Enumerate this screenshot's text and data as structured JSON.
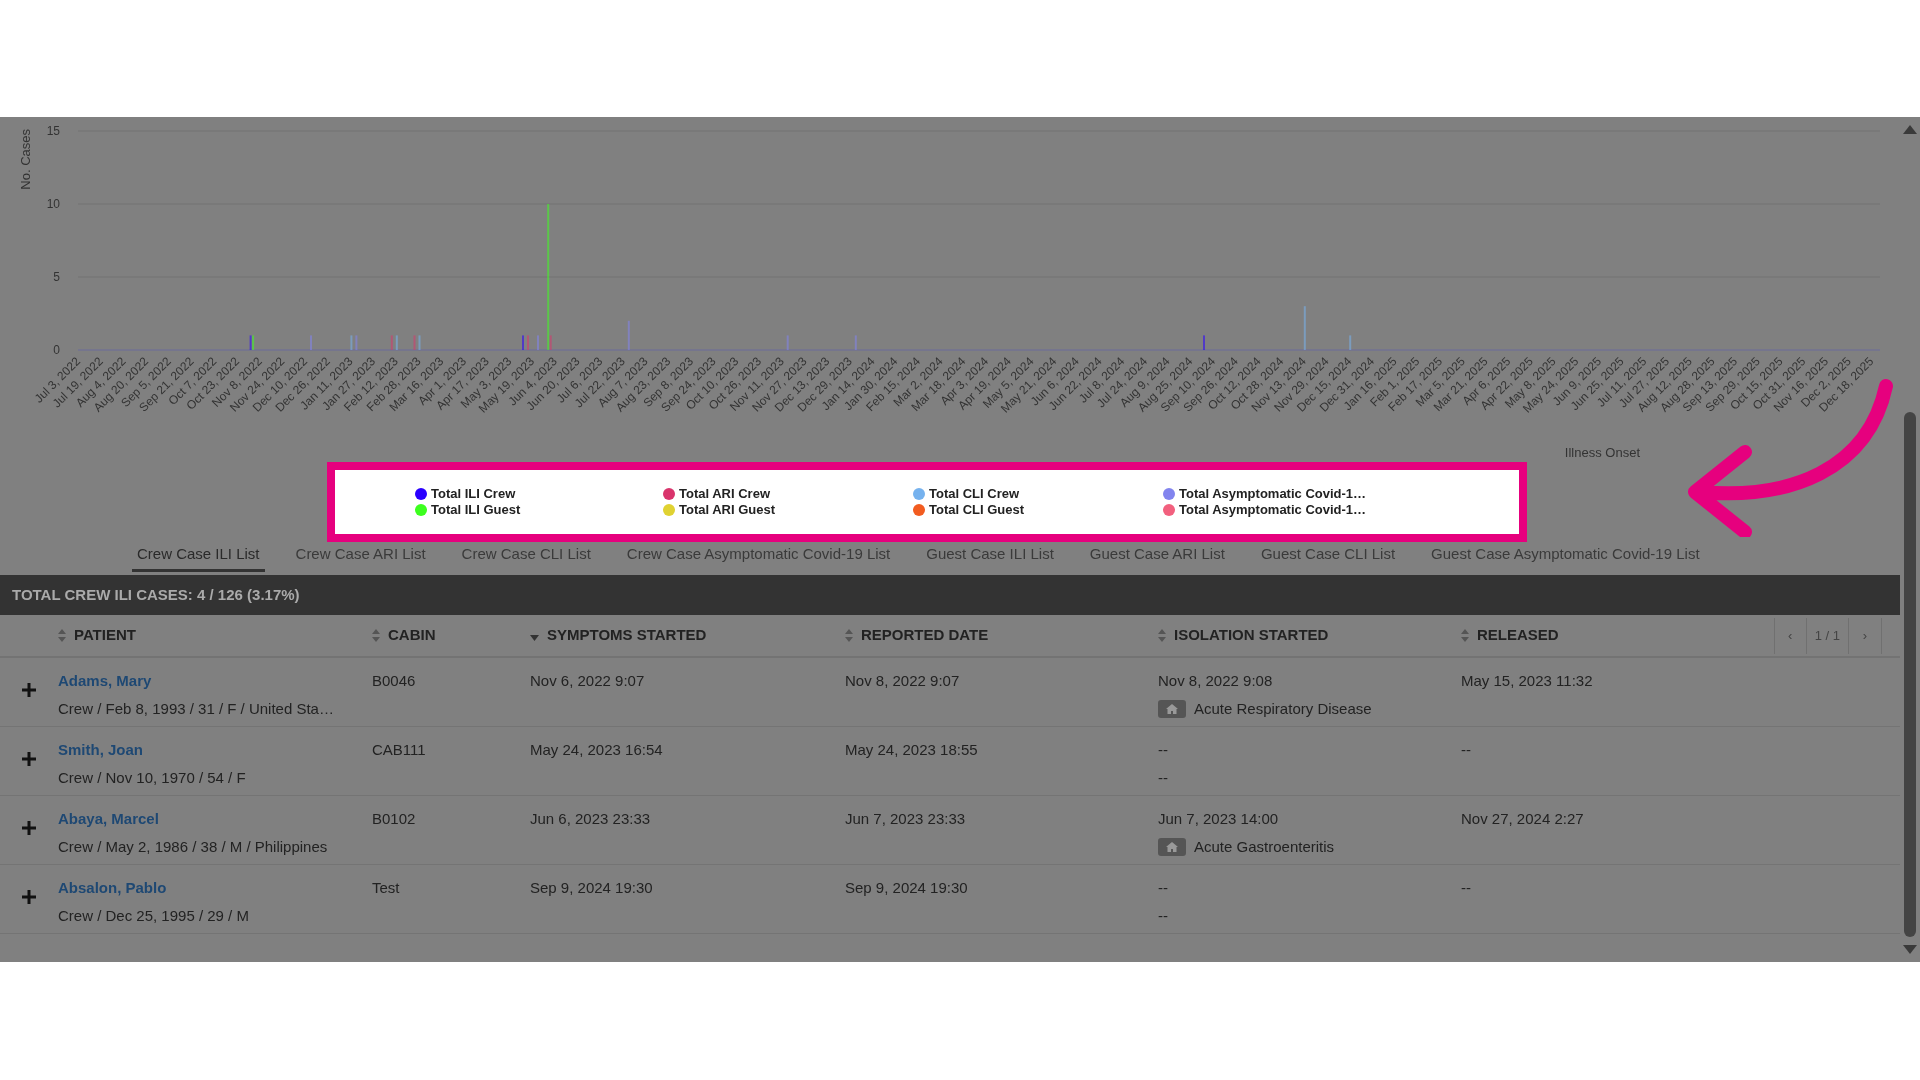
{
  "chart": {
    "chart_data": {
      "type": "bar",
      "ylabel": "No. Cases",
      "xlabel": "Illness Onset",
      "ylim": [
        0,
        15
      ],
      "yticks": [
        0,
        5,
        10,
        15
      ],
      "categories": [
        "Jul 3, 2022",
        "Jul 19, 2022",
        "Aug 4, 2022",
        "Aug 20, 2022",
        "Sep 5, 2022",
        "Sep 21, 2022",
        "Oct 7, 2022",
        "Oct 23, 2022",
        "Nov 8, 2022",
        "Nov 24, 2022",
        "Dec 10, 2022",
        "Dec 26, 2022",
        "Jan 11, 2023",
        "Jan 27, 2023",
        "Feb 12, 2023",
        "Feb 28, 2023",
        "Mar 16, 2023",
        "Apr 1, 2023",
        "Apr 17, 2023",
        "May 3, 2023",
        "May 19, 2023",
        "Jun 4, 2023",
        "Jun 20, 2023",
        "Jul 6, 2023",
        "Jul 22, 2023",
        "Aug 7, 2023",
        "Aug 23, 2023",
        "Sep 8, 2023",
        "Sep 24, 2023",
        "Oct 10, 2023",
        "Oct 26, 2023",
        "Nov 11, 2023",
        "Nov 27, 2023",
        "Dec 13, 2023",
        "Dec 29, 2023",
        "Jan 14, 2024",
        "Jan 30, 2024",
        "Feb 15, 2024",
        "Mar 2, 2024",
        "Mar 18, 2024",
        "Apr 3, 2024",
        "Apr 19, 2024",
        "May 5, 2024",
        "May 21, 2024",
        "Jun 6, 2024",
        "Jun 22, 2024",
        "Jul 8, 2024",
        "Jul 24, 2024",
        "Aug 9, 2024",
        "Aug 25, 2024",
        "Sep 10, 2024",
        "Sep 26, 2024",
        "Oct 12, 2024",
        "Oct 28, 2024",
        "Nov 13, 2024",
        "Nov 29, 2024",
        "Dec 15, 2024",
        "Dec 31, 2024",
        "Jan 16, 2025",
        "Feb 1, 2025",
        "Feb 17, 2025",
        "Mar 5, 2025",
        "Mar 21, 2025",
        "Apr 6, 2025",
        "Apr 22, 2025",
        "May 8, 2025",
        "May 24, 2025",
        "Jun 9, 2025",
        "Jun 25, 2025",
        "Jul 11, 2025",
        "Jul 27, 2025",
        "Aug 12, 2025",
        "Aug 28, 2025",
        "Sep 13, 2025",
        "Sep 29, 2025",
        "Oct 15, 2025",
        "Oct 31, 2025",
        "Nov 16, 2025",
        "Dec 2, 2025",
        "Dec 18, 2025"
      ],
      "series": [
        {
          "name": "Total ILI Crew",
          "color": "#2a00ff",
          "values": [
            0,
            0,
            0,
            0,
            0,
            0,
            0,
            0,
            1,
            0,
            0,
            0,
            0,
            0,
            0,
            0,
            0,
            0,
            0,
            0,
            1,
            0,
            0,
            0,
            0,
            0,
            0,
            0,
            0,
            0,
            0,
            0,
            0,
            0,
            0,
            0,
            0,
            0,
            0,
            0,
            0,
            0,
            0,
            0,
            0,
            0,
            0,
            0,
            0,
            0,
            1,
            0,
            0,
            0,
            0,
            0,
            0,
            0,
            0,
            0,
            0,
            0,
            0,
            0,
            0,
            0,
            0,
            0,
            0,
            0,
            0,
            0,
            0,
            0,
            0,
            0,
            0,
            0,
            0,
            0
          ]
        },
        {
          "name": "Total ILI Guest",
          "color": "#3cff1e",
          "values": [
            0,
            0,
            0,
            0,
            0,
            0,
            0,
            0,
            1,
            0,
            0,
            0,
            0,
            0,
            0,
            0,
            0,
            0,
            0,
            0,
            0,
            10,
            0,
            0,
            0,
            0,
            0,
            0,
            0,
            0,
            0,
            0,
            0,
            0,
            0,
            0,
            0,
            0,
            0,
            0,
            0,
            0,
            0,
            0,
            0,
            0,
            0,
            0,
            0,
            0,
            0,
            0,
            0,
            0,
            0,
            0,
            0,
            0,
            0,
            0,
            0,
            0,
            0,
            0,
            0,
            0,
            0,
            0,
            0,
            0,
            0,
            0,
            0,
            0,
            0,
            0,
            0,
            0,
            0,
            0
          ]
        },
        {
          "name": "Total ARI Crew",
          "color": "#d9346c",
          "values": [
            0,
            0,
            0,
            0,
            0,
            0,
            0,
            0,
            0,
            0,
            0,
            0,
            0,
            0,
            1,
            1,
            0,
            0,
            0,
            0,
            1,
            1,
            0,
            0,
            0,
            0,
            0,
            0,
            0,
            0,
            0,
            0,
            0,
            0,
            0,
            0,
            0,
            0,
            0,
            0,
            0,
            0,
            0,
            0,
            0,
            0,
            0,
            0,
            0,
            0,
            0,
            0,
            0,
            0,
            0,
            0,
            0,
            0,
            0,
            0,
            0,
            0,
            0,
            0,
            0,
            0,
            0,
            0,
            0,
            0,
            0,
            0,
            0,
            0,
            0,
            0,
            0,
            0,
            0,
            0
          ]
        },
        {
          "name": "Total ARI Guest",
          "color": "#e0d232",
          "values": [
            0,
            0,
            0,
            0,
            0,
            0,
            0,
            0,
            0,
            0,
            0,
            0,
            0,
            0,
            0,
            0,
            0,
            0,
            0,
            0,
            0,
            0,
            0,
            0,
            0,
            0,
            0,
            0,
            0,
            0,
            0,
            0,
            0,
            0,
            0,
            0,
            0,
            0,
            0,
            0,
            0,
            0,
            0,
            0,
            0,
            0,
            0,
            0,
            0,
            0,
            0,
            0,
            0,
            0,
            0,
            0,
            0,
            0,
            0,
            0,
            0,
            0,
            0,
            0,
            0,
            0,
            0,
            0,
            0,
            0,
            0,
            0,
            0,
            0,
            0,
            0,
            0,
            0,
            0,
            0
          ]
        },
        {
          "name": "Total CLI Crew",
          "color": "#76b2ee",
          "values": [
            0,
            0,
            0,
            0,
            0,
            0,
            0,
            0,
            0,
            0,
            0,
            0,
            1,
            0,
            1,
            1,
            0,
            0,
            0,
            0,
            0,
            0,
            0,
            0,
            0,
            0,
            0,
            0,
            0,
            0,
            0,
            0,
            0,
            0,
            0,
            0,
            0,
            0,
            0,
            0,
            0,
            0,
            0,
            0,
            0,
            0,
            0,
            0,
            0,
            0,
            0,
            0,
            0,
            0,
            3,
            0,
            1,
            0,
            0,
            0,
            0,
            0,
            0,
            0,
            0,
            0,
            0,
            0,
            0,
            0,
            0,
            0,
            0,
            0,
            0,
            0,
            0,
            0,
            0,
            0
          ]
        },
        {
          "name": "Total CLI Guest",
          "color": "#f25c20",
          "values": [
            0,
            0,
            0,
            0,
            0,
            0,
            0,
            0,
            0,
            0,
            0,
            0,
            0,
            0,
            0,
            0,
            0,
            0,
            0,
            0,
            0,
            0,
            0,
            0,
            0,
            0,
            0,
            0,
            0,
            0,
            0,
            0,
            0,
            0,
            0,
            0,
            0,
            0,
            0,
            0,
            0,
            0,
            0,
            0,
            0,
            0,
            0,
            0,
            0,
            0,
            0,
            0,
            0,
            0,
            0,
            0,
            0,
            0,
            0,
            0,
            0,
            0,
            0,
            0,
            0,
            0,
            0,
            0,
            0,
            0,
            0,
            0,
            0,
            0,
            0,
            0,
            0,
            0,
            0,
            0
          ]
        },
        {
          "name": "Total Asymptomatic Covid-1…",
          "color": "#8284ee",
          "values": [
            0,
            0,
            0,
            0,
            0,
            0,
            0,
            0,
            0,
            0,
            1,
            0,
            1,
            0,
            0,
            0,
            0,
            0,
            0,
            0,
            1,
            0,
            0,
            0,
            2,
            0,
            0,
            0,
            0,
            0,
            0,
            1,
            0,
            0,
            1,
            0,
            0,
            0,
            0,
            0,
            0,
            0,
            0,
            0,
            0,
            0,
            0,
            0,
            0,
            0,
            0,
            0,
            0,
            0,
            0,
            0,
            0,
            0,
            0,
            0,
            0,
            0,
            0,
            0,
            0,
            0,
            0,
            0,
            0,
            0,
            0,
            0,
            0,
            0,
            0,
            0,
            0,
            0,
            0,
            0
          ]
        },
        {
          "name": "Total Asymptomatic Covid-1…",
          "color": "#f2607e",
          "values": [
            0,
            0,
            0,
            0,
            0,
            0,
            0,
            0,
            0,
            0,
            0,
            0,
            0,
            0,
            0,
            0,
            0,
            0,
            0,
            0,
            0,
            0,
            0,
            0,
            0,
            0,
            0,
            0,
            0,
            0,
            0,
            0,
            0,
            0,
            0,
            0,
            0,
            0,
            0,
            0,
            0,
            0,
            0,
            0,
            0,
            0,
            0,
            0,
            0,
            0,
            0,
            0,
            0,
            0,
            0,
            0,
            0,
            0,
            0,
            0,
            0,
            0,
            0,
            0,
            0,
            0,
            0,
            0,
            0,
            0,
            0,
            0,
            0,
            0,
            0,
            0,
            0,
            0,
            0,
            0
          ]
        }
      ]
    }
  },
  "tabs": [
    {
      "label": "Crew Case ILI List",
      "selected": true
    },
    {
      "label": "Crew Case ARI List",
      "selected": false
    },
    {
      "label": "Crew Case CLI List",
      "selected": false
    },
    {
      "label": "Crew Case Asymptomatic Covid-19 List",
      "selected": false
    },
    {
      "label": "Guest Case ILI List",
      "selected": false
    },
    {
      "label": "Guest Case ARI List",
      "selected": false
    },
    {
      "label": "Guest Case CLI List",
      "selected": false
    },
    {
      "label": "Guest Case Asymptomatic Covid-19 List",
      "selected": false
    }
  ],
  "summary": "TOTAL CREW ILI CASES: 4 / 126 (3.17%)",
  "table": {
    "columns": [
      {
        "label": "PATIENT",
        "sorted": false
      },
      {
        "label": "CABIN",
        "sorted": false
      },
      {
        "label": "SYMPTOMS STARTED",
        "sorted": true
      },
      {
        "label": "REPORTED DATE",
        "sorted": false
      },
      {
        "label": "ISOLATION STARTED",
        "sorted": false
      },
      {
        "label": "RELEASED",
        "sorted": false
      }
    ],
    "pagination": {
      "previous": "‹",
      "page": "1 / 1",
      "next": "›"
    },
    "rows": [
      {
        "name": "Adams, Mary",
        "details": "Crew / Feb 8, 1993 / 31 / F / United Sta…",
        "cabin": "B0046",
        "symptoms": "Nov 6, 2022 9:07",
        "reported": "Nov 8, 2022 9:07",
        "isolation": "Nov 8, 2022 9:08",
        "isolation_note": {
          "text": "Acute Respiratory Disease",
          "home_icon": true
        },
        "released": "May 15, 2023 11:32"
      },
      {
        "name": "Smith, Joan",
        "details": "Crew / Nov 10, 1970 / 54 / F",
        "cabin": "CAB111",
        "symptoms": "May 24, 2023 16:54",
        "reported": "May 24, 2023 18:55",
        "isolation": "--",
        "isolation_note": {
          "text": "--",
          "home_icon": false
        },
        "released": "--"
      },
      {
        "name": "Abaya, Marcel",
        "details": "Crew / May 2, 1986 / 38 / M / Philippines",
        "cabin": "B0102",
        "symptoms": "Jun 6, 2023 23:33",
        "reported": "Jun 7, 2023 23:33",
        "isolation": "Jun 7, 2023 14:00",
        "isolation_note": {
          "text": "Acute Gastroenteritis",
          "home_icon": true
        },
        "released": "Nov 27, 2024 2:27"
      },
      {
        "name": "Absalon, Pablo",
        "details": "Crew / Dec 25, 1995 / 29 / M",
        "cabin": "Test",
        "symptoms": "Sep 9, 2024 19:30",
        "reported": "Sep 9, 2024 19:30",
        "isolation": "--",
        "isolation_note": {
          "text": "--",
          "home_icon": false
        },
        "released": "--"
      }
    ]
  }
}
